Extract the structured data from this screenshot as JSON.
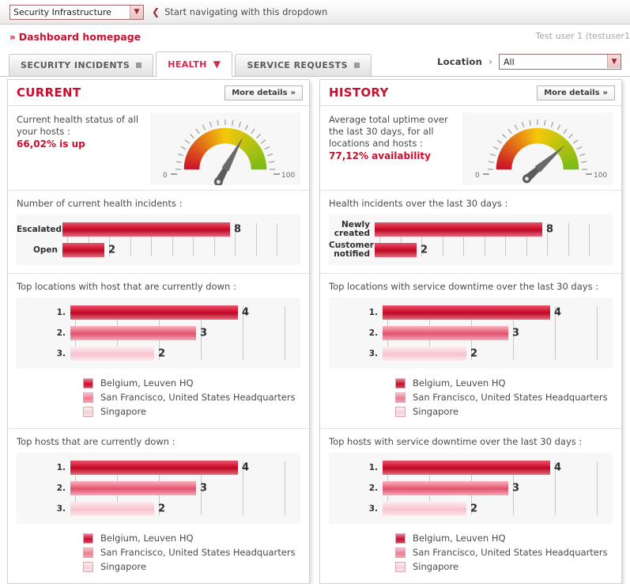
{
  "topbar": {
    "app_select_value": "Security Infrastructure",
    "app_select_options": [
      "Security Infrastructure"
    ],
    "hint_chevron": "chevron-left-icon",
    "hint_text": "Start navigating with this dropdown"
  },
  "breadcrumb": {
    "marker": "»",
    "label": "Dashboard homepage",
    "user": "Test user 1 (testuser1"
  },
  "tabs": [
    {
      "label": "SECURITY INCIDENTS",
      "icon": "square-icon",
      "active": false
    },
    {
      "label": "HEALTH",
      "icon": "chevron-down-icon",
      "active": true
    },
    {
      "label": "SERVICE REQUESTS",
      "icon": "square-icon",
      "active": false
    }
  ],
  "location_filter": {
    "label": "Location",
    "arrow": "›",
    "value": "All",
    "options": [
      "All"
    ]
  },
  "colors": {
    "brand_red": "#c8102e",
    "series1": "#ce0e2d",
    "series2": "#ea5f79",
    "series3": "#f8c9d3",
    "tab_active_text": "#d3294b"
  },
  "panels": [
    {
      "id": "current",
      "title": "CURRENT",
      "more_label": "More details",
      "more_marker": "»",
      "gauge": {
        "description": "Current health status of all your hosts :",
        "kpi": "66,02% is up",
        "min_label": "0",
        "max_label": "100",
        "value_pct": 66.02
      },
      "sections": [
        {
          "label": "Number of current health incidents :",
          "chart": {
            "type": "bar",
            "orientation": "horizontal",
            "categories": [
              "Escalated",
              "Open"
            ],
            "values": [
              8,
              2
            ],
            "max": 10,
            "gridlines": 10,
            "colors": [
              "#ce0e2d",
              "#ce0e2d"
            ]
          },
          "legend": []
        },
        {
          "label": "Top locations with host that are currently down :",
          "chart": {
            "type": "bar",
            "orientation": "horizontal",
            "categories": [
              "1.",
              "2.",
              "3."
            ],
            "values": [
              4,
              3,
              2
            ],
            "max": 5,
            "gridlines": 5,
            "colors": [
              "#ce0e2d",
              "#ea5f79",
              "#f8c9d3"
            ]
          },
          "legend": [
            "Belgium, Leuven HQ",
            "San Francisco, United States Headquarters",
            "Singapore"
          ]
        },
        {
          "label": "Top hosts that are currently down :",
          "chart": {
            "type": "bar",
            "orientation": "horizontal",
            "categories": [
              "1.",
              "2.",
              "3."
            ],
            "values": [
              4,
              3,
              2
            ],
            "max": 5,
            "gridlines": 5,
            "colors": [
              "#ce0e2d",
              "#ea5f79",
              "#f8c9d3"
            ]
          },
          "legend": [
            "Belgium, Leuven HQ",
            "San Francisco, United States Headquarters",
            "Singapore"
          ]
        }
      ]
    },
    {
      "id": "history",
      "title": "HISTORY",
      "more_label": "More details",
      "more_marker": "»",
      "gauge": {
        "description": "Average total uptime over the last 30 days, for all locations and hosts :",
        "kpi": "77,12% availability",
        "min_label": "0",
        "max_label": "100",
        "value_pct": 77.12
      },
      "sections": [
        {
          "label": "Health incidents over the last 30 days :",
          "chart": {
            "type": "bar",
            "orientation": "horizontal",
            "categories": [
              "Newly created",
              "Customer notified"
            ],
            "values": [
              8,
              2
            ],
            "max": 10,
            "gridlines": 10,
            "colors": [
              "#ce0e2d",
              "#ce0e2d"
            ]
          },
          "legend": []
        },
        {
          "label": "Top locations with service downtime over the last 30 days :",
          "chart": {
            "type": "bar",
            "orientation": "horizontal",
            "categories": [
              "1.",
              "2.",
              "3."
            ],
            "values": [
              4,
              3,
              2
            ],
            "max": 5,
            "gridlines": 5,
            "colors": [
              "#ce0e2d",
              "#ea5f79",
              "#f8c9d3"
            ]
          },
          "legend": [
            "Belgium, Leuven HQ",
            "San Francisco, United States Headquarters",
            "Singapore"
          ]
        },
        {
          "label": "Top hosts with service downtime over the last 30 days :",
          "chart": {
            "type": "bar",
            "orientation": "horizontal",
            "categories": [
              "1.",
              "2.",
              "3."
            ],
            "values": [
              4,
              3,
              2
            ],
            "max": 5,
            "gridlines": 5,
            "colors": [
              "#ce0e2d",
              "#ea5f79",
              "#f8c9d3"
            ]
          },
          "legend": [
            "Belgium, Leuven HQ",
            "San Francisco, United States Headquarters",
            "Singapore"
          ]
        }
      ]
    }
  ],
  "chart_data": [
    {
      "type": "bar",
      "title": "Number of current health incidents :",
      "categories": [
        "Escalated",
        "Open"
      ],
      "values": [
        8,
        2
      ],
      "xlabel": "",
      "ylabel": "",
      "xlim": [
        0,
        10
      ],
      "grid": true,
      "legend": "none"
    },
    {
      "type": "bar",
      "title": "Top locations with host that are currently down :",
      "categories": [
        "1.",
        "2.",
        "3."
      ],
      "values": [
        4,
        3,
        2
      ],
      "legend_entries": [
        "Belgium, Leuven HQ",
        "San Francisco, United States Headquarters",
        "Singapore"
      ],
      "xlabel": "",
      "ylabel": "",
      "xlim": [
        0,
        5
      ],
      "grid": true,
      "legend": "bottom"
    },
    {
      "type": "bar",
      "title": "Top hosts that are currently down :",
      "categories": [
        "1.",
        "2.",
        "3."
      ],
      "values": [
        4,
        3,
        2
      ],
      "legend_entries": [
        "Belgium, Leuven HQ",
        "San Francisco, United States Headquarters",
        "Singapore"
      ],
      "xlabel": "",
      "ylabel": "",
      "xlim": [
        0,
        5
      ],
      "grid": true,
      "legend": "bottom"
    },
    {
      "type": "bar",
      "title": "Health incidents over the last 30 days :",
      "categories": [
        "Newly created",
        "Customer notified"
      ],
      "values": [
        8,
        2
      ],
      "xlabel": "",
      "ylabel": "",
      "xlim": [
        0,
        10
      ],
      "grid": true,
      "legend": "none"
    },
    {
      "type": "bar",
      "title": "Top locations with service downtime over the last 30 days :",
      "categories": [
        "1.",
        "2.",
        "3."
      ],
      "values": [
        4,
        3,
        2
      ],
      "legend_entries": [
        "Belgium, Leuven HQ",
        "San Francisco, United States Headquarters",
        "Singapore"
      ],
      "xlabel": "",
      "ylabel": "",
      "xlim": [
        0,
        5
      ],
      "grid": true,
      "legend": "bottom"
    },
    {
      "type": "bar",
      "title": "Top hosts with service downtime over the last 30 days :",
      "categories": [
        "1.",
        "2.",
        "3."
      ],
      "values": [
        4,
        3,
        2
      ],
      "legend_entries": [
        "Belgium, Leuven HQ",
        "San Francisco, United States Headquarters",
        "Singapore"
      ],
      "xlabel": "",
      "ylabel": "",
      "xlim": [
        0,
        5
      ],
      "grid": true,
      "legend": "bottom"
    },
    {
      "type": "gauge",
      "title": "Current health status of all your hosts :",
      "value": 66.02,
      "min": 0,
      "max": 100,
      "tick_labels": [
        "0",
        "100"
      ],
      "annotation": "66,02% is up"
    },
    {
      "type": "gauge",
      "title": "Average total uptime over the last 30 days, for all locations and hosts :",
      "value": 77.12,
      "min": 0,
      "max": 100,
      "tick_labels": [
        "0",
        "100"
      ],
      "annotation": "77,12% availability"
    }
  ]
}
